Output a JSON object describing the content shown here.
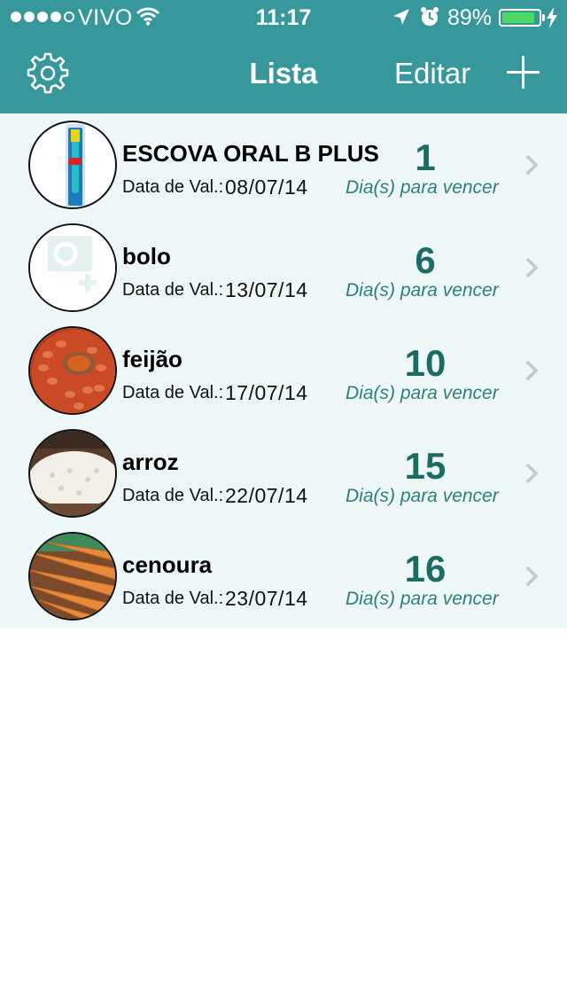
{
  "status_bar": {
    "carrier": "VIVO",
    "time": "11:17",
    "battery_percent": "89%",
    "battery_level": 0.89,
    "signal_bars_filled": 4,
    "signal_bars_total": 5
  },
  "nav": {
    "title": "Lista",
    "edit_label": "Editar",
    "settings_icon": "gear-icon",
    "add_icon": "plus-icon"
  },
  "items": [
    {
      "name": "ESCOVA ORAL B PLUS",
      "date_label": "Data de Val.:",
      "date": "08/07/14",
      "days": "1",
      "days_label": "Dia(s) para vencer",
      "image": "toothbrush"
    },
    {
      "name": "bolo",
      "date_label": "Data de Val.:",
      "date": "13/07/14",
      "days": "6",
      "days_label": "Dia(s) para vencer",
      "image": "camera-placeholder"
    },
    {
      "name": "feijão",
      "date_label": "Data de Val.:",
      "date": "17/07/14",
      "days": "10",
      "days_label": "Dia(s) para vencer",
      "image": "beans"
    },
    {
      "name": "arroz",
      "date_label": "Data de Val.:",
      "date": "22/07/14",
      "days": "15",
      "days_label": "Dia(s) para vencer",
      "image": "rice"
    },
    {
      "name": "cenoura",
      "date_label": "Data de Val.:",
      "date": "23/07/14",
      "days": "16",
      "days_label": "Dia(s) para vencer",
      "image": "carrots"
    }
  ],
  "colors": {
    "header": "#36989a",
    "list_background": "#eef7f7",
    "days_number": "#1d6b67",
    "days_label": "#2e7f7a",
    "battery_fill": "#4cd964"
  }
}
